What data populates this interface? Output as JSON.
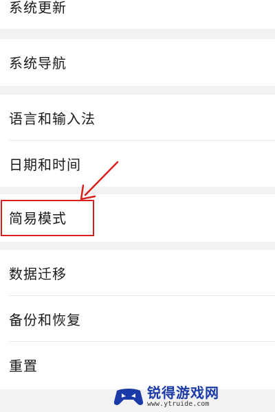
{
  "settings": {
    "items": [
      {
        "label": "系统更新"
      },
      {
        "label": "系统导航"
      },
      {
        "label": "语言和输入法"
      },
      {
        "label": "日期和时间"
      },
      {
        "label": "简易模式"
      },
      {
        "label": "数据迁移"
      },
      {
        "label": "备份和恢复"
      },
      {
        "label": "重置"
      }
    ]
  },
  "annotation": {
    "highlight_color": "#d91e1e",
    "highlighted_item": "简易模式"
  },
  "watermark": {
    "title": "锐得游戏网",
    "url": "www.ytruide.com",
    "brand_color": "#1a3aa8"
  }
}
